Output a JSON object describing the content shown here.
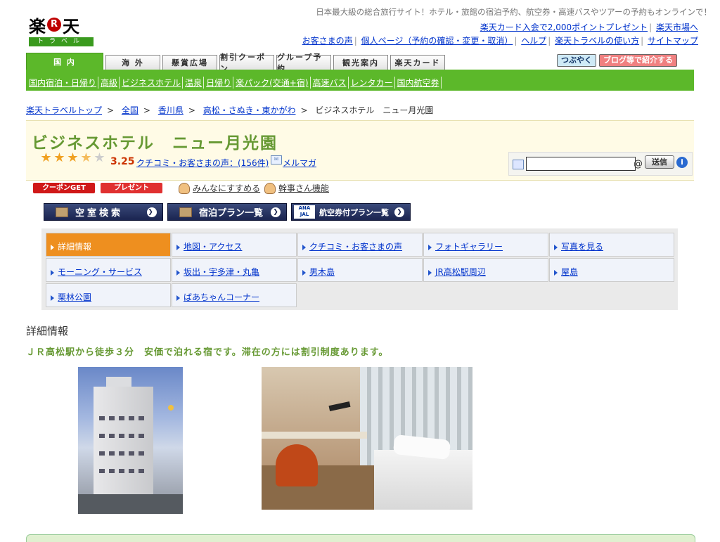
{
  "logo": {
    "left": "楽",
    "mark": "R",
    "right": "天",
    "sub": "トラベル"
  },
  "header": {
    "tagline": "日本最大級の総合旅行サイト！ホテル・旅館の宿泊予約、航空券・高速バスやツアーの予約もオンラインで！",
    "links_row1": [
      "楽天カード入会で2,000ポイントプレゼント",
      "楽天市場へ"
    ],
    "links_row2": [
      "お客さまの声",
      "個人ページ（予約の確認・変更・取消）",
      "ヘルプ",
      "楽天トラベルの使い方",
      "サイトマップ"
    ]
  },
  "tabs": [
    "国 内",
    "海 外",
    "懸賞広場",
    "割引クーポン",
    "グループ予約",
    "観光案内",
    "楽天カード"
  ],
  "social": {
    "tweet": "つぶやく",
    "blog": "ブログ等で紹介する"
  },
  "subnav": [
    "国内宿泊・日帰り",
    "高級",
    "ビジネスホテル",
    "温泉",
    "日帰り",
    "楽パック(交通+宿)",
    "高速バス",
    "レンタカー",
    "国内航空券"
  ],
  "breadcrumb": {
    "items": [
      "楽天トラベルトップ",
      "全国",
      "香川県",
      "高松・さぬき・東かがわ"
    ],
    "current": "ビジネスホテル　ニュー月光園",
    "separator": ">"
  },
  "hotel": {
    "name": "ビジネスホテル　ニュー月光園",
    "rating": "3.25",
    "stars": [
      "full",
      "full",
      "full",
      "half",
      "empty"
    ],
    "reviews_link": "クチコミ・お客さまの声：(156件)",
    "mailmag": "メルマガ",
    "mail_placeholder": "",
    "at": "@",
    "send": "送信",
    "help": "i"
  },
  "actions": {
    "coupon": "クーポンGET",
    "present": "プレゼント",
    "recommend": "みんなにすすめる",
    "kanji": "幹事さん機能"
  },
  "big_buttons": {
    "vacancy": "空室検索",
    "plans": "宿泊プラン一覧",
    "air_logo": "ANA JAL",
    "air": "航空券付プラン一覧",
    "arrow": "❯"
  },
  "menu": [
    "詳細情報",
    "地図・アクセス",
    "クチコミ・お客さまの声",
    "フォトギャラリー",
    "写真を見る",
    "モーニング・サービス",
    "坂出・宇多津・丸亀",
    "男木島",
    "JR高松駅周辺",
    "屋島",
    "栗林公園",
    "ばあちゃんコーナー"
  ],
  "content": {
    "section_title": "詳細情報",
    "catchphrase": "ＪＲ高松駅から徒歩３分　安価で泊れる宿です。滞在の方には割引制度あります。"
  },
  "colors": {
    "green": "#5cb82a",
    "orange_active": "#ee8f1f",
    "title_green": "#669933",
    "link_blue": "#0033cc"
  }
}
